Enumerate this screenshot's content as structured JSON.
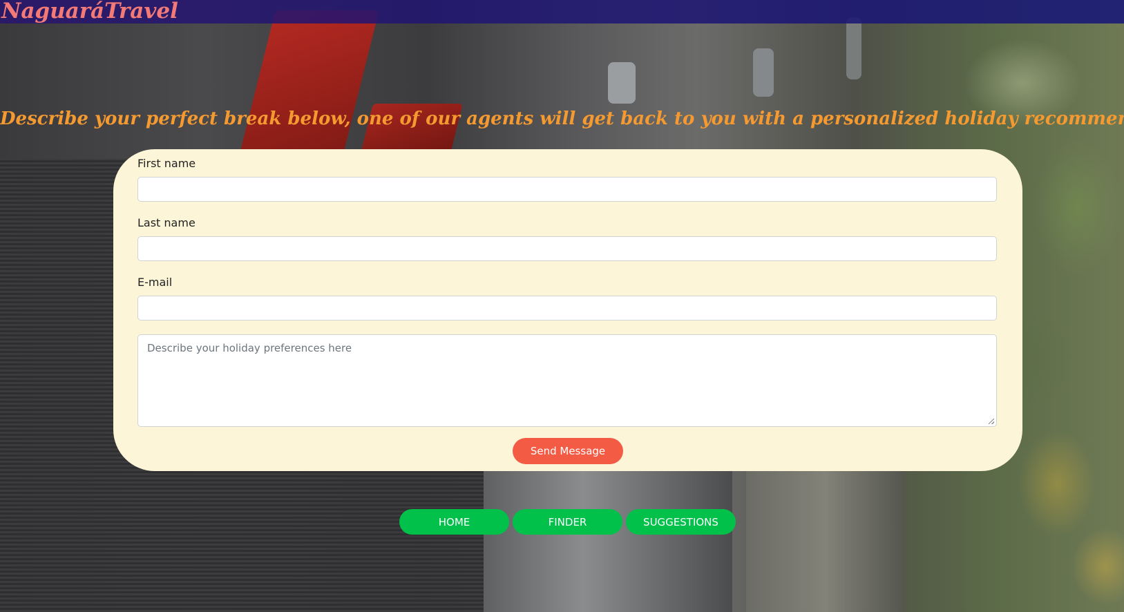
{
  "brand": {
    "logo_text": "NaguaráTravel"
  },
  "headline": "Describe your perfect break below, one of our agents will get back to you with a personalized holiday recommendation",
  "form": {
    "first_name_label": "First name",
    "first_name_value": "",
    "last_name_label": "Last name",
    "last_name_value": "",
    "email_label": "E-mail",
    "email_value": "",
    "message_placeholder": "Describe your holiday preferences here",
    "send_label": "Send Message"
  },
  "nav": {
    "items": [
      {
        "label": "HOME"
      },
      {
        "label": "FINDER"
      },
      {
        "label": "SUGGESTIONS"
      }
    ]
  },
  "colors": {
    "topbar": "#1a1478",
    "logo": "#f47a78",
    "headline": "#f59a31",
    "card": "#fdf5d8",
    "send_button": "#f45b45",
    "nav_button": "#02c14b"
  }
}
